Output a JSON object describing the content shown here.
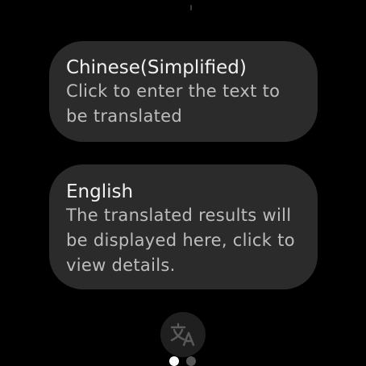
{
  "source_card": {
    "language": "Chinese(Simplified)",
    "placeholder": "Click to enter the text to be translated"
  },
  "target_card": {
    "language": "English",
    "placeholder": "The translated results will be displayed here, click to view details."
  },
  "translate_button": {
    "icon": "translate-icon"
  },
  "pager": {
    "pages": 2,
    "active_index": 0
  },
  "colors": {
    "background": "#000000",
    "card": "#2b2b2b",
    "primary_text": "#f2f2f2",
    "secondary_text": "#bdbdbd",
    "dot_active": "#ffffff",
    "dot_inactive": "#555555"
  }
}
